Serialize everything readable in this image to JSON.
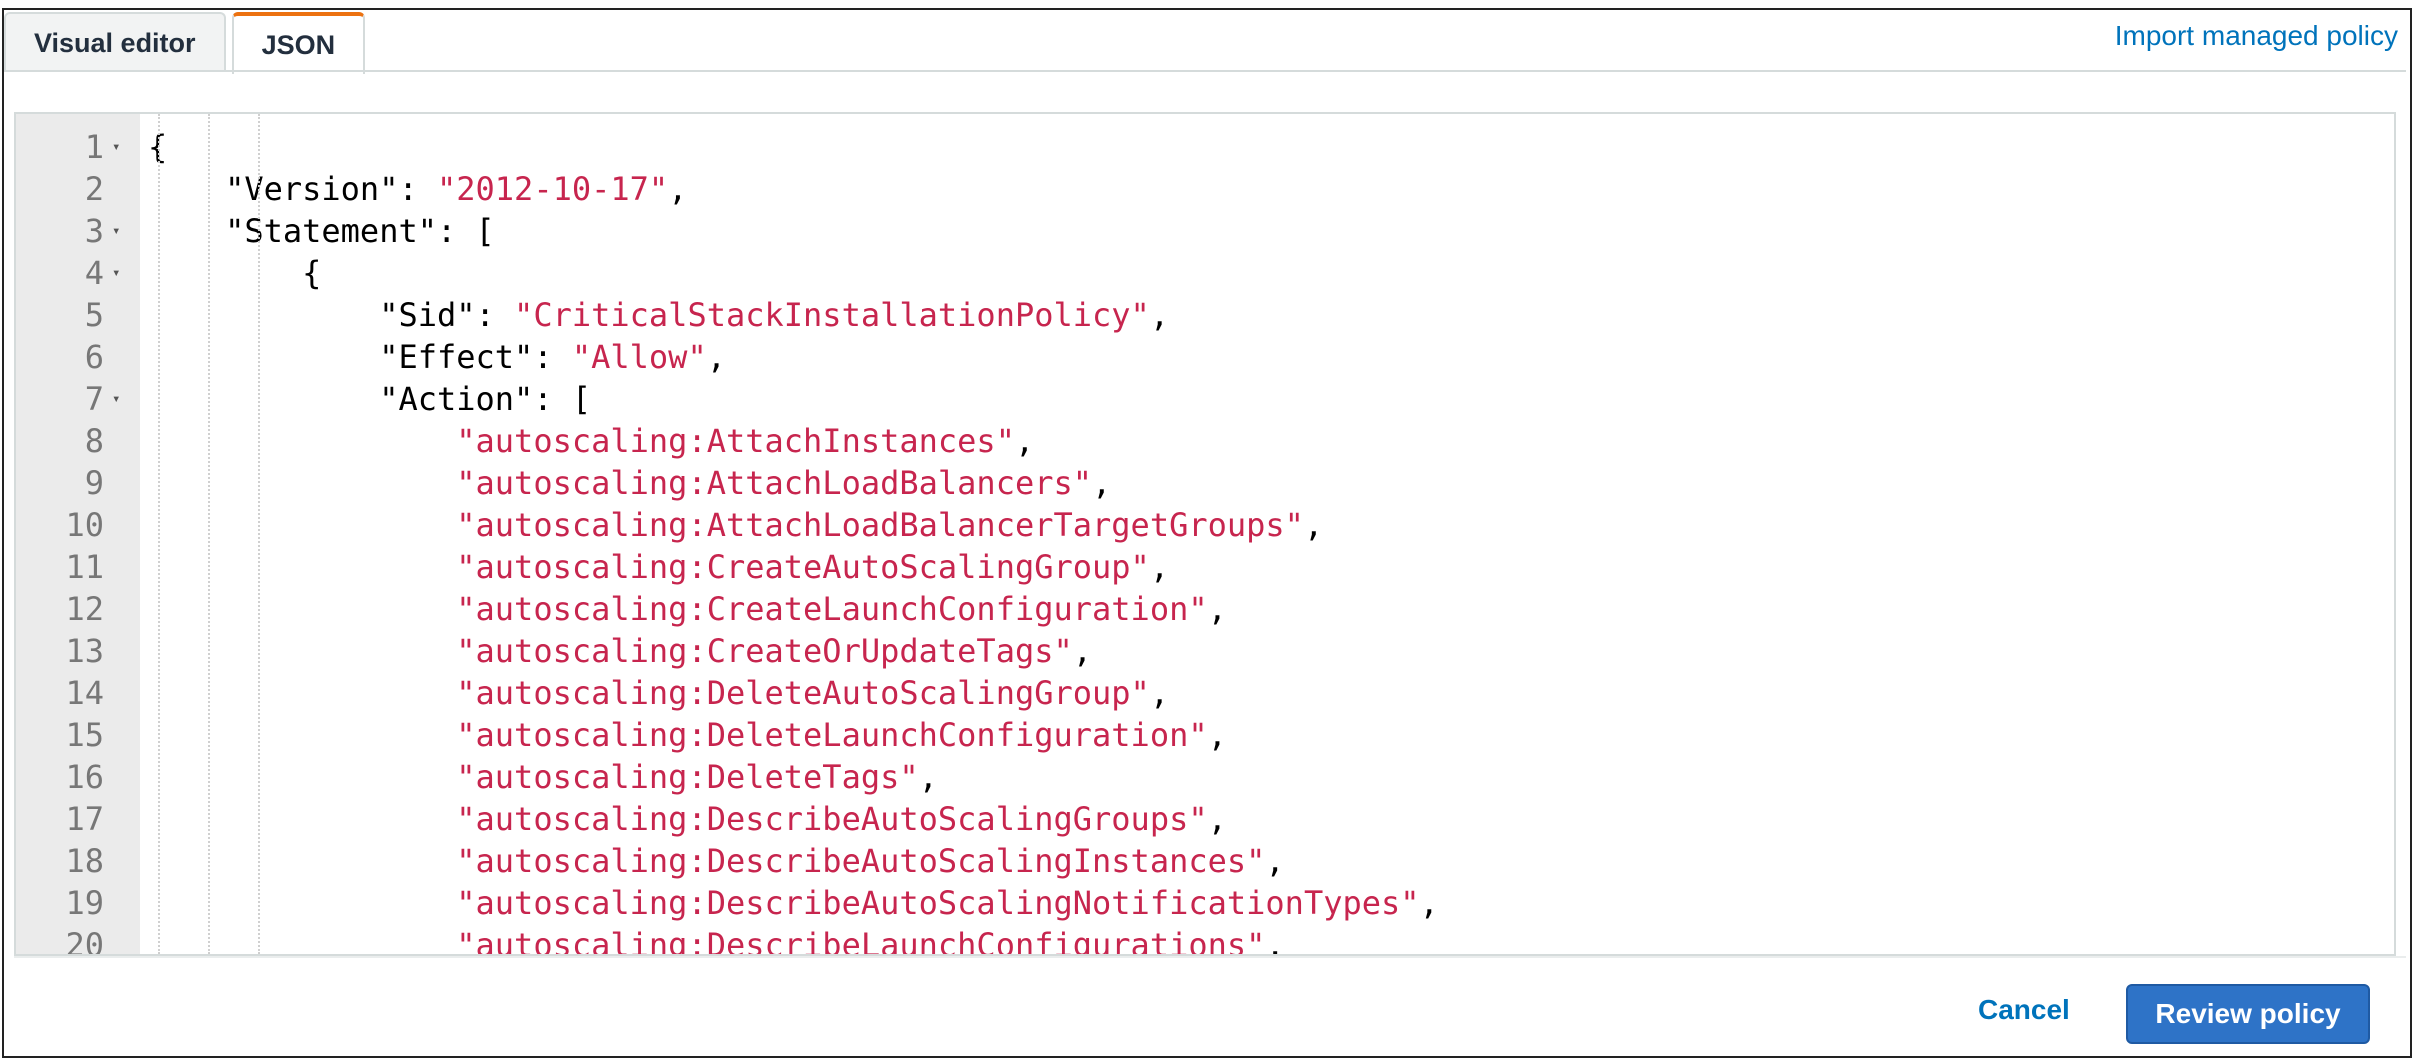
{
  "tabs": [
    {
      "label": "Visual editor",
      "active": false
    },
    {
      "label": "JSON",
      "active": true
    }
  ],
  "import_link": "Import managed policy",
  "editor": {
    "lines": [
      {
        "num": "1",
        "fold": true,
        "code": "{"
      },
      {
        "num": "2",
        "fold": false,
        "code": "    \"Version\": \"2012-10-17\","
      },
      {
        "num": "3",
        "fold": true,
        "code": "    \"Statement\": ["
      },
      {
        "num": "4",
        "fold": true,
        "code": "        {"
      },
      {
        "num": "5",
        "fold": false,
        "code": "            \"Sid\": \"CriticalStackInstallationPolicy\","
      },
      {
        "num": "6",
        "fold": false,
        "code": "            \"Effect\": \"Allow\","
      },
      {
        "num": "7",
        "fold": true,
        "code": "            \"Action\": ["
      },
      {
        "num": "8",
        "fold": false,
        "code": "                \"autoscaling:AttachInstances\","
      },
      {
        "num": "9",
        "fold": false,
        "code": "                \"autoscaling:AttachLoadBalancers\","
      },
      {
        "num": "10",
        "fold": false,
        "code": "                \"autoscaling:AttachLoadBalancerTargetGroups\","
      },
      {
        "num": "11",
        "fold": false,
        "code": "                \"autoscaling:CreateAutoScalingGroup\","
      },
      {
        "num": "12",
        "fold": false,
        "code": "                \"autoscaling:CreateLaunchConfiguration\","
      },
      {
        "num": "13",
        "fold": false,
        "code": "                \"autoscaling:CreateOrUpdateTags\","
      },
      {
        "num": "14",
        "fold": false,
        "code": "                \"autoscaling:DeleteAutoScalingGroup\","
      },
      {
        "num": "15",
        "fold": false,
        "code": "                \"autoscaling:DeleteLaunchConfiguration\","
      },
      {
        "num": "16",
        "fold": false,
        "code": "                \"autoscaling:DeleteTags\","
      },
      {
        "num": "17",
        "fold": false,
        "code": "                \"autoscaling:DescribeAutoScalingGroups\","
      },
      {
        "num": "18",
        "fold": false,
        "code": "                \"autoscaling:DescribeAutoScalingInstances\","
      },
      {
        "num": "19",
        "fold": false,
        "code": "                \"autoscaling:DescribeAutoScalingNotificationTypes\","
      },
      {
        "num": "20",
        "fold": false,
        "code": "                \"autoscaling:DescribeLaunchConfigurations\","
      }
    ]
  },
  "footer": {
    "cancel_label": "Cancel",
    "review_label": "Review policy"
  }
}
